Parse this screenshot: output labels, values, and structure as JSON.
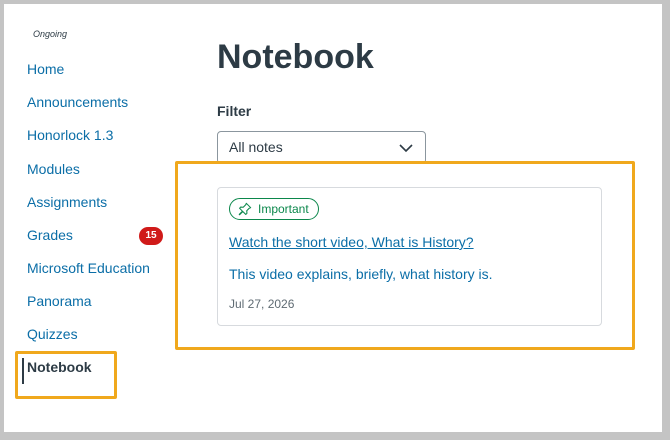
{
  "sidebar": {
    "term": "Ongoing",
    "items": [
      {
        "label": "Home"
      },
      {
        "label": "Announcements"
      },
      {
        "label": "Honorlock 1.3"
      },
      {
        "label": "Modules"
      },
      {
        "label": "Assignments"
      },
      {
        "label": "Grades",
        "badge": "15"
      },
      {
        "label": "Microsoft Education"
      },
      {
        "label": "Panorama"
      },
      {
        "label": "Quizzes"
      },
      {
        "label": "Notebook",
        "active": true
      }
    ]
  },
  "main": {
    "title": "Notebook",
    "filter": {
      "label": "Filter",
      "selected": "All notes"
    },
    "notes": [
      {
        "tag": "Important",
        "title": "Watch the short video, What is History?",
        "description": "This video explains, briefly, what history is.",
        "date": "Jul 27, 2026"
      }
    ]
  },
  "colors": {
    "link": "#0b6ea7",
    "text": "#2d3b45",
    "badge": "#d01a19",
    "success": "#0b874b",
    "highlight": "#f0a81c"
  },
  "icons": {
    "chevron": "chevron-down-icon",
    "pin": "pin-icon"
  }
}
